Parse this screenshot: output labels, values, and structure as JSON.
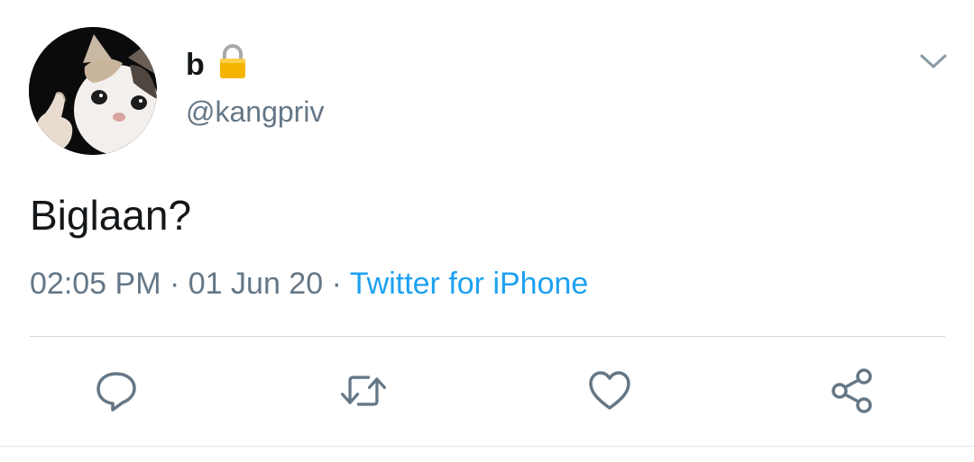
{
  "tweet": {
    "display_name": "b",
    "handle": "@kangpriv",
    "text": "Biglaan?",
    "time": "02:05 PM",
    "date": "01 Jun 20",
    "separator": "·",
    "source": "Twitter for iPhone"
  },
  "icons": {
    "lock": "lock-icon",
    "caret": "chevron-down-icon",
    "reply": "reply-icon",
    "retweet": "retweet-icon",
    "like": "heart-icon",
    "share": "share-icon"
  },
  "colors": {
    "text": "#14171a",
    "secondary": "#657786",
    "link": "#1da1f2",
    "divider": "#ccd6dd"
  }
}
